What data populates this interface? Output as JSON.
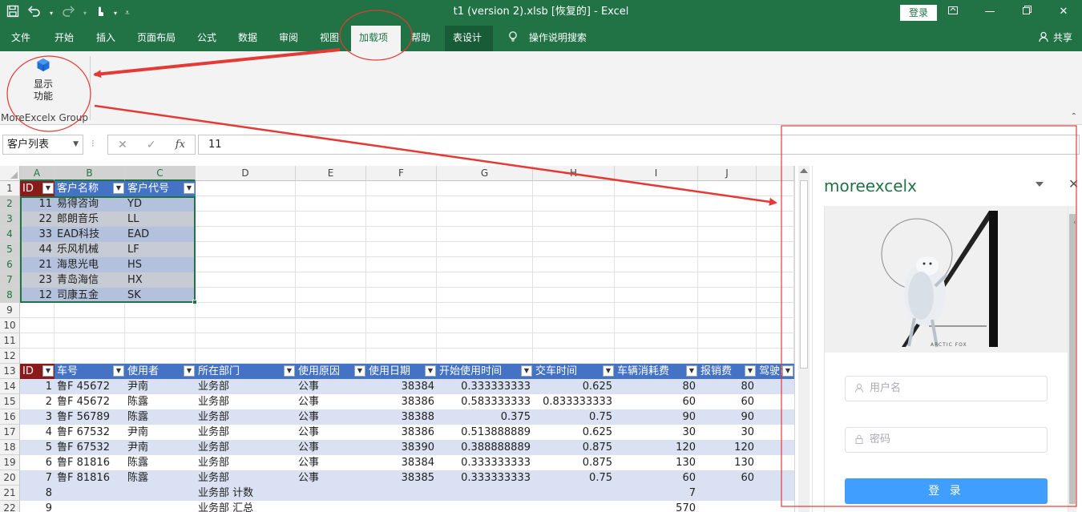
{
  "window": {
    "title": "t1 (version 2).xlsb [恢复的] - Excel",
    "login_label": "登录",
    "share_label": "共享",
    "tell_me": "操作说明搜索"
  },
  "tabs": [
    "文件",
    "开始",
    "插入",
    "页面布局",
    "公式",
    "数据",
    "审阅",
    "视图",
    "加载项",
    "帮助",
    "表设计"
  ],
  "active_tab": "加载项",
  "ribbon": {
    "button_label_line1": "显示",
    "button_label_line2": "功能",
    "group_label": "MoreExcelx Group"
  },
  "formula_bar": {
    "name_box": "客户列表",
    "formula": "11",
    "fx_label": "fx"
  },
  "columns": [
    "A",
    "B",
    "C",
    "D",
    "E",
    "F",
    "G",
    "H",
    "I",
    "J"
  ],
  "rows": [
    "1",
    "2",
    "3",
    "4",
    "5",
    "6",
    "7",
    "8",
    "9",
    "10",
    "11",
    "12",
    "13",
    "14",
    "15",
    "16",
    "17",
    "18",
    "19",
    "20",
    "21",
    "22"
  ],
  "customer_table": {
    "headers": [
      "ID",
      "客户名称",
      "客户代号"
    ],
    "rows": [
      [
        "11",
        "易得咨询",
        "YD"
      ],
      [
        "22",
        "郎朗音乐",
        "LL"
      ],
      [
        "33",
        "EAD科技",
        "EAD"
      ],
      [
        "44",
        "乐风机械",
        "LF"
      ],
      [
        "21",
        "海思光电",
        "HS"
      ],
      [
        "23",
        "青岛海信",
        "HX"
      ],
      [
        "12",
        "司康五金",
        "SK"
      ]
    ]
  },
  "vehicle_table": {
    "headers": [
      "ID",
      "车号",
      "使用者",
      "所在部门",
      "使用原因",
      "使用日期",
      "开始使用时间",
      "交车时间",
      "车辆消耗费",
      "报销费",
      "驾驶员"
    ],
    "rows": [
      [
        "1",
        "鲁F 45672",
        "尹南",
        "业务部",
        "公事",
        "38384",
        "0.333333333",
        "0.625",
        "80",
        "80",
        ""
      ],
      [
        "2",
        "鲁F 45672",
        "陈露",
        "业务部",
        "公事",
        "38386",
        "0.583333333",
        "0.833333333",
        "60",
        "60",
        ""
      ],
      [
        "3",
        "鲁F 56789",
        "陈露",
        "业务部",
        "公事",
        "38388",
        "0.375",
        "0.75",
        "90",
        "90",
        ""
      ],
      [
        "4",
        "鲁F 67532",
        "尹南",
        "业务部",
        "公事",
        "38386",
        "0.513888889",
        "0.625",
        "30",
        "30",
        ""
      ],
      [
        "5",
        "鲁F 67532",
        "尹南",
        "业务部",
        "公事",
        "38390",
        "0.388888889",
        "0.875",
        "120",
        "120",
        ""
      ],
      [
        "6",
        "鲁F 81816",
        "陈露",
        "业务部",
        "公事",
        "38384",
        "0.333333333",
        "0.875",
        "130",
        "130",
        ""
      ],
      [
        "7",
        "鲁F 81816",
        "陈露",
        "业务部",
        "公事",
        "38385",
        "0.333333333",
        "0.75",
        "60",
        "60",
        ""
      ],
      [
        "8",
        "",
        "",
        "业务部 计数",
        "",
        "",
        "",
        "",
        "7",
        "",
        ""
      ],
      [
        "9",
        "",
        "",
        "业务部 汇总",
        "",
        "",
        "",
        "",
        "570",
        "",
        ""
      ]
    ]
  },
  "task_pane": {
    "title": "moreexcelx",
    "art_caption": "ARCTIC FOX",
    "username_placeholder": "用户名",
    "password_placeholder": "密码",
    "submit_label": "登 录"
  },
  "colors": {
    "excel_green": "#217346",
    "table_header_blue": "#4472c4",
    "id_header_red": "#8b1a1a",
    "button_blue": "#409eff",
    "annotation_red": "#e53935"
  }
}
